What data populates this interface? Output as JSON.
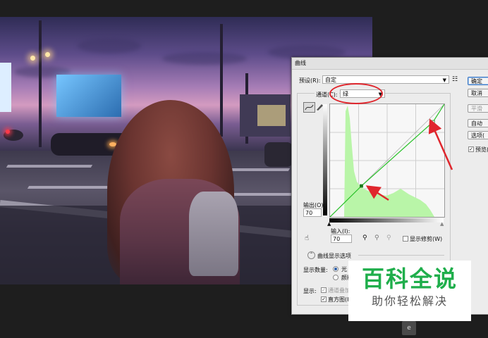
{
  "dialog": {
    "title": "曲线",
    "preset_label": "预设(R):",
    "preset_value": "自定",
    "preset_menu_icon": "list-menu-icon",
    "channel_label": "通道(C):",
    "channel_value": "绿",
    "output_label": "输出(O):",
    "output_value": "70",
    "input_label": "输入(I):",
    "input_value": "70",
    "show_clipping_label": "显示修剪(W)",
    "curve_display_options_label": "曲线显示选项",
    "show_amount_label": "显示数量:",
    "show_amount_options": [
      "光",
      "颜料"
    ],
    "show_label": "显示:",
    "show_channel_overlays_label": "通道叠加",
    "show_histogram_label": "直方图(H)",
    "buttons": {
      "ok": "确定",
      "cancel": "取消",
      "smooth": "平滑",
      "auto": "自动",
      "options": "选项(",
      "preview": "预览("
    }
  },
  "curve": {
    "points_input": [
      0,
      70,
      230,
      255
    ],
    "points_output": [
      0,
      70,
      215,
      255
    ],
    "histogram_color": "#b9f5a8",
    "curve_color": "#29c229"
  },
  "annotations": {
    "highlight_color": "#e0262d"
  },
  "watermark": {
    "title": "百科全说",
    "subtitle": "助你轻松解决",
    "title_color": "#1fae4b"
  },
  "small_logo": "e"
}
